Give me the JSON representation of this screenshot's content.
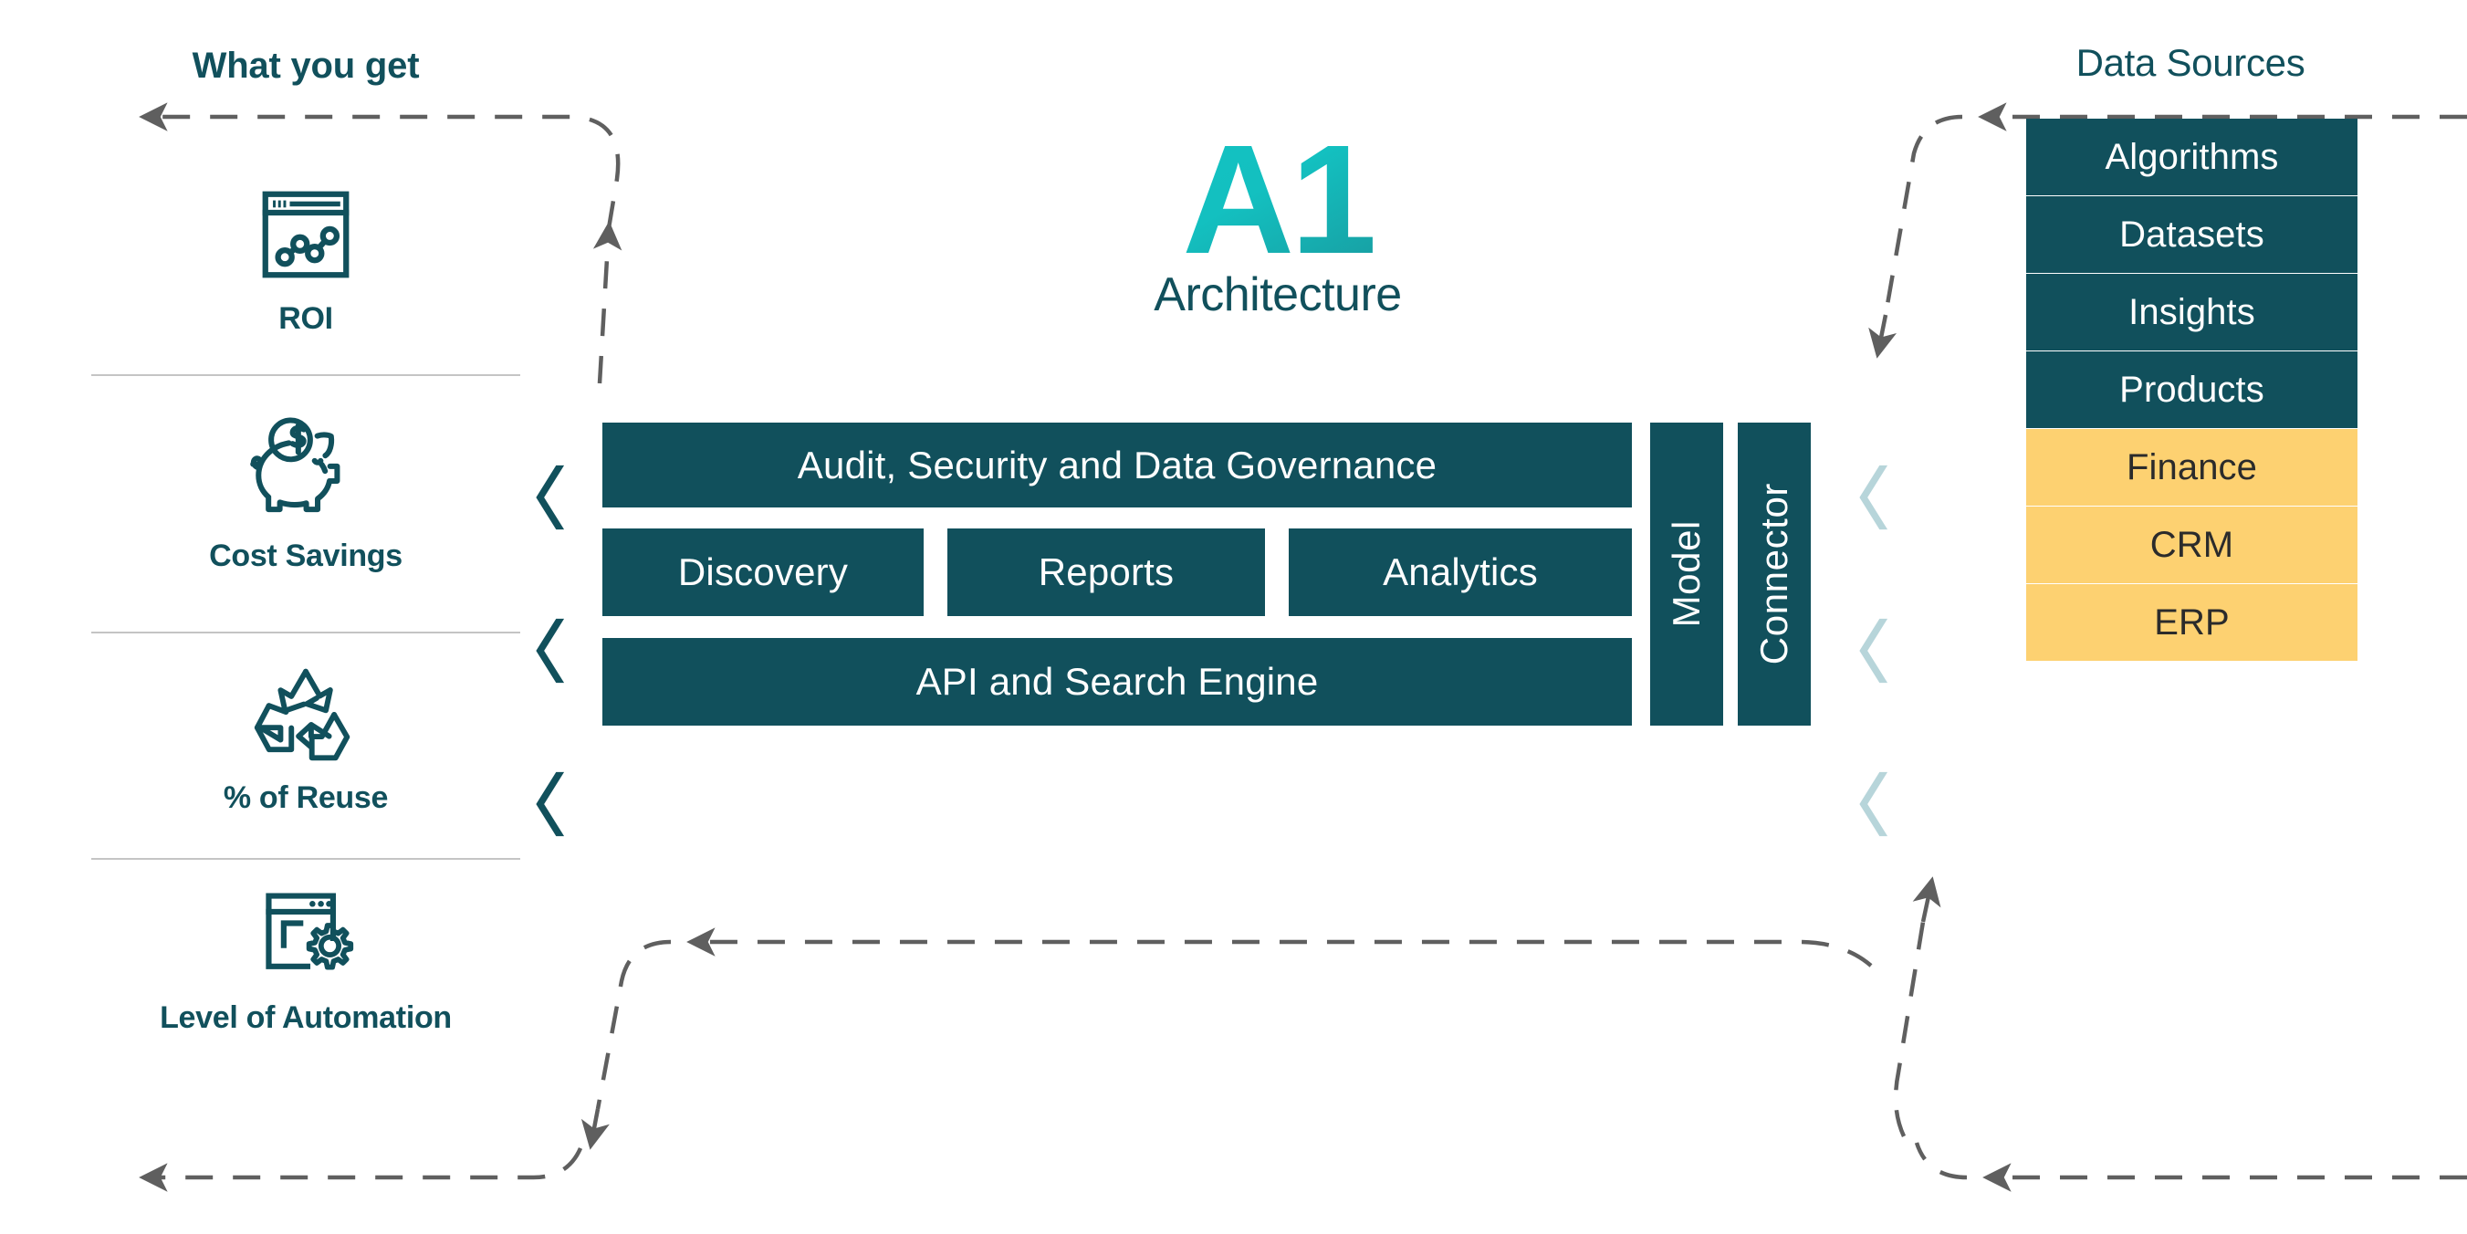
{
  "colors": {
    "teal": "#11505C",
    "teal_light": "#12BFC0",
    "gold": "#FDD171",
    "chevron_left": "#11505C",
    "chevron_right": "#B7D5DA",
    "divider": "#C4C4C4",
    "arrow": "#5F5F5F",
    "gold_text": "#2B2B2B",
    "block_text": "#FFFFFF"
  },
  "left": {
    "title": "What you get",
    "metrics": [
      {
        "label": "ROI",
        "icon": "chart-window-icon"
      },
      {
        "label": "Cost Savings",
        "icon": "piggy-bank-icon"
      },
      {
        "label": "% of Reuse",
        "icon": "recycle-icon"
      },
      {
        "label": "Level of Automation",
        "icon": "window-gear-icon"
      }
    ]
  },
  "center": {
    "logo": "A1",
    "subtitle": "Architecture",
    "layers": {
      "top_bar": "Audit, Security and Data Governance",
      "middle_blocks": [
        "Discovery",
        "Reports",
        "Analytics"
      ],
      "bottom_bar": "API and Search Engine"
    },
    "columns": [
      "Model",
      "Connector"
    ]
  },
  "right": {
    "title": "Data Sources",
    "sources": [
      {
        "label": "Algorithms",
        "style": "teal"
      },
      {
        "label": "Datasets",
        "style": "teal"
      },
      {
        "label": "Insights",
        "style": "teal"
      },
      {
        "label": "Products",
        "style": "teal"
      },
      {
        "label": "Finance",
        "style": "gold"
      },
      {
        "label": "CRM",
        "style": "gold"
      },
      {
        "label": "ERP",
        "style": "gold"
      }
    ]
  },
  "flow": {
    "chevrons_left": [
      "chevron-left-icon",
      "chevron-left-icon",
      "chevron-left-icon"
    ],
    "chevrons_right": [
      "chevron-left-icon",
      "chevron-left-icon",
      "chevron-left-icon"
    ],
    "loops": [
      "upper-feedback-loop",
      "lower-feedback-loop"
    ]
  }
}
